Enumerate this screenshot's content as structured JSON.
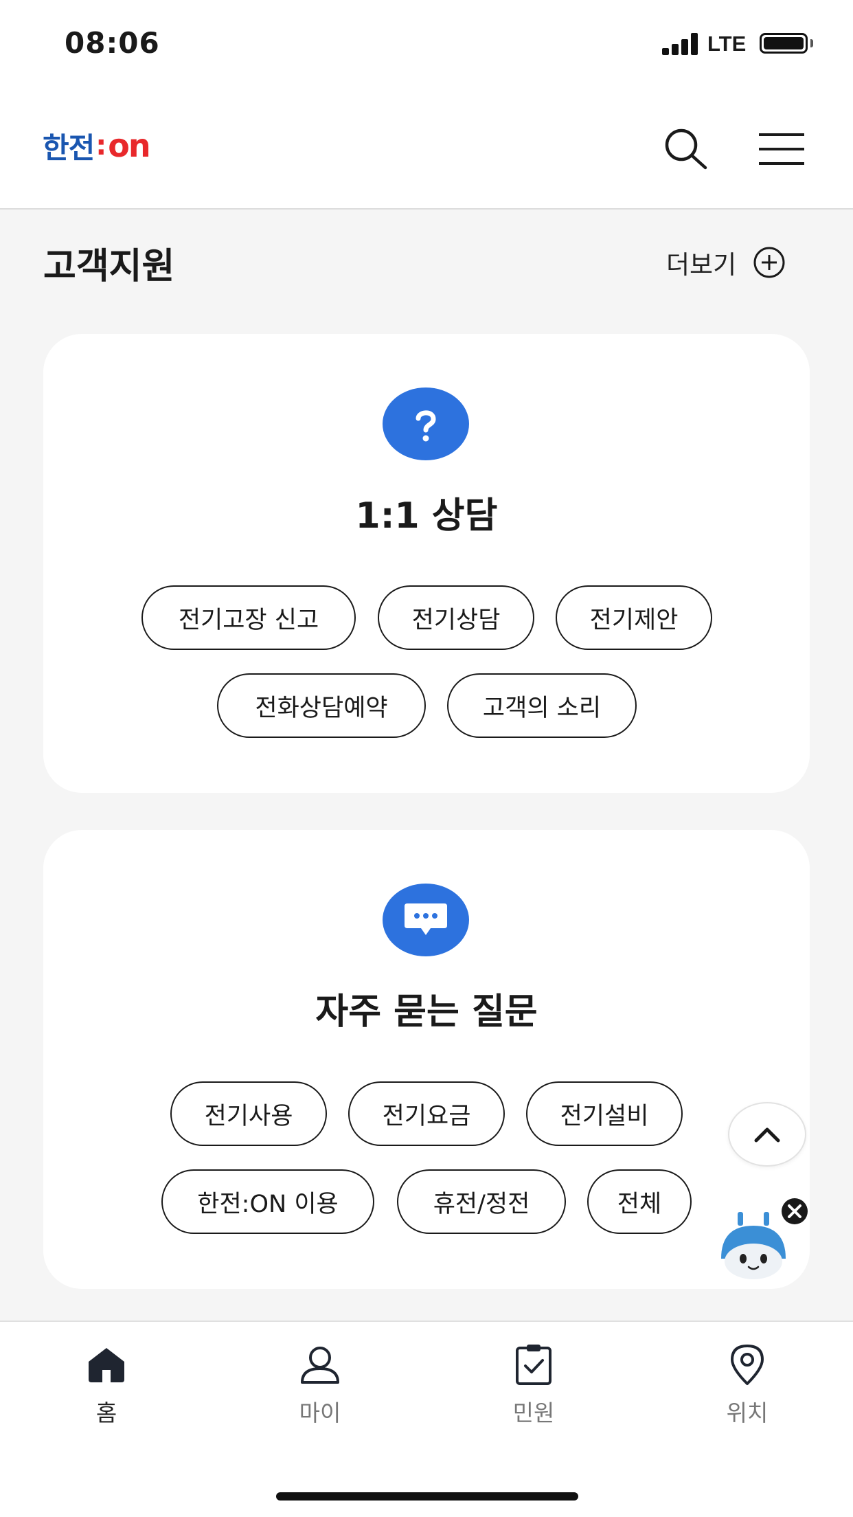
{
  "status_bar": {
    "time": "08:06",
    "network": "LTE"
  },
  "header": {
    "logo_text_kr": "한전",
    "logo_colon": ":",
    "logo_text_on": "on"
  },
  "section": {
    "title": "고객지원",
    "more_label": "더보기"
  },
  "consult_card": {
    "title": "1:1 상담",
    "chips": [
      "전기고장 신고",
      "전기상담",
      "전기제안",
      "전화상담예약",
      "고객의 소리"
    ]
  },
  "faq_card": {
    "title": "자주 묻는 질문",
    "chips": [
      "전기사용",
      "전기요금",
      "전기설비",
      "한전:ON 이용",
      "휴전/정전",
      "전체"
    ]
  },
  "bottom_nav": {
    "items": [
      {
        "label": "홈",
        "icon": "home-icon"
      },
      {
        "label": "마이",
        "icon": "person-icon"
      },
      {
        "label": "민원",
        "icon": "clipboard-check-icon"
      },
      {
        "label": "위치",
        "icon": "location-pin-icon"
      }
    ],
    "active_index": 0
  },
  "colors": {
    "accent_blue": "#2d72de",
    "logo_blue": "#1a56b0",
    "logo_red": "#e8282b"
  }
}
